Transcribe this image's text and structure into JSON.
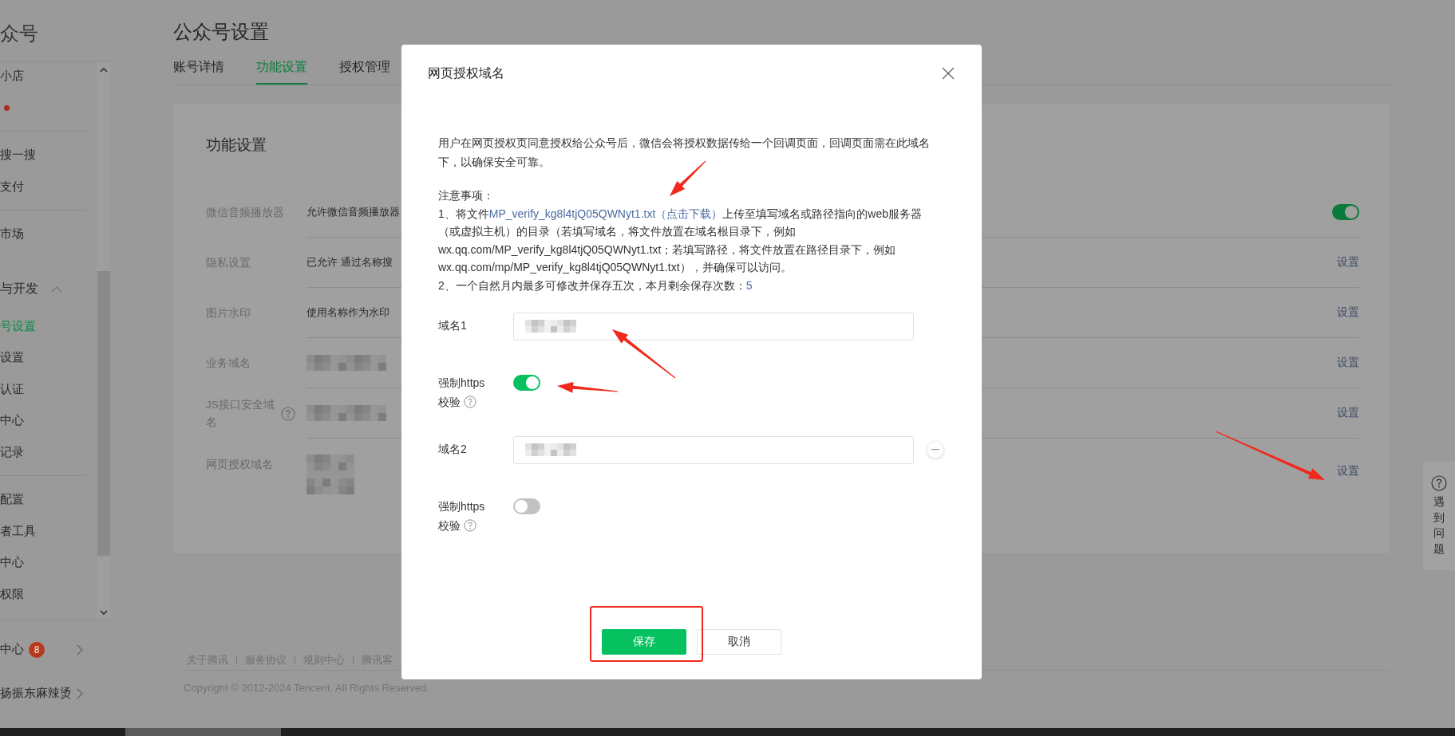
{
  "sidebar": {
    "title": "众号",
    "groups": [
      {
        "divider_after": true,
        "items": [
          {
            "kind": "link",
            "label": "小店",
            "selected": false
          },
          {
            "kind": "dot",
            "selected": false
          }
        ]
      },
      {
        "divider_after": true,
        "items": [
          {
            "kind": "link",
            "label": "搜一搜",
            "selected": false
          },
          {
            "kind": "link",
            "label": "支付",
            "selected": false
          }
        ]
      },
      {
        "divider_after": false,
        "items": [
          {
            "kind": "link",
            "label": "市场",
            "selected": false
          }
        ]
      },
      {
        "divider_after": true,
        "header": {
          "label": "与开发",
          "expanded": true
        },
        "items": [
          {
            "kind": "link",
            "label": "号设置",
            "selected": true
          },
          {
            "kind": "link",
            "label": "设置",
            "selected": false
          },
          {
            "kind": "link",
            "label": "认证",
            "selected": false
          },
          {
            "kind": "link",
            "label": "中心",
            "selected": false
          },
          {
            "kind": "link",
            "label": "记录",
            "selected": false
          }
        ]
      },
      {
        "divider_after": false,
        "items": [
          {
            "kind": "link",
            "label": "配置",
            "selected": false
          },
          {
            "kind": "link",
            "label": "者工具",
            "selected": false
          },
          {
            "kind": "link",
            "label": "中心",
            "selected": false
          },
          {
            "kind": "link",
            "label": "权限",
            "selected": false
          }
        ]
      }
    ],
    "bottom_items": [
      {
        "label": "中心",
        "badge": "8"
      },
      {
        "label": "扬振东麻辣烫"
      }
    ]
  },
  "page": {
    "title": "公众号设置",
    "tabs": [
      {
        "label": "账号详情",
        "selected": false
      },
      {
        "label": "功能设置",
        "selected": true
      },
      {
        "label": "授权管理",
        "selected": false
      }
    ]
  },
  "settings": {
    "title": "功能设置",
    "rows": [
      {
        "kind": "toggle",
        "label": "微信音频播放器",
        "value": "允许微信音频播放器",
        "on": true
      },
      {
        "kind": "link",
        "label": "隐私设置",
        "value": "已允许 通过名称搜",
        "action": "设置"
      },
      {
        "kind": "link",
        "label": "图片水印",
        "value": "使用名称作为水印",
        "action": "设置"
      },
      {
        "kind": "link",
        "label": "业务域名",
        "redacted": true,
        "redacted_multiline": false,
        "action": "设置"
      },
      {
        "kind": "link",
        "label": "JS接口安全域名",
        "help": true,
        "redacted": true,
        "redacted_multiline": false,
        "action": "设置"
      },
      {
        "kind": "link",
        "label": "网页授权域名",
        "redacted": true,
        "redacted_multiline": true,
        "action": "设置"
      }
    ]
  },
  "footer": {
    "links": [
      "关于腾讯",
      "服务协议",
      "规则中心",
      "腾讯客"
    ],
    "copyright": "Copyright © 2012-2024 Tencent. All Rights Reserved."
  },
  "help_float": {
    "label": "遇到问题"
  },
  "modal": {
    "title": "网页授权域名",
    "intro": "用户在网页授权页同意授权给公众号后，微信会将授权数据传给一个回调页面，回调页面需在此域名下，以确保安全可靠。",
    "notes_title": "注意事项：",
    "note_1": {
      "before": "1、将文件",
      "link": "MP_verify_kg8l4tjQ05QWNyt1.txt（点击下载）",
      "after": "上传至填写域名或路径指向的web服务器（或虚拟主机）的目录（若填写域名，将文件放置在域名根目录下，例如wx.qq.com/MP_verify_kg8l4tjQ05QWNyt1.txt；若填写路径，将文件放置在路径目录下，例如wx.qq.com/mp/MP_verify_kg8l4tjQ05QWNyt1.txt），并确保可以访问。"
    },
    "note_2": {
      "text": "2、一个自然月内最多可修改并保存五次，本月剩余保存次数：",
      "count": "5"
    },
    "domains": [
      {
        "label": "域名1",
        "value_redacted": true,
        "removable": false,
        "https_label": "强制https",
        "https_label_2": "校验",
        "https_enforced": true
      },
      {
        "label": "域名2",
        "value_redacted": true,
        "removable": true,
        "https_label": "强制https",
        "https_label_2": "校验",
        "https_enforced": false
      }
    ],
    "buttons": {
      "primary": "保存",
      "secondary": "取消"
    }
  }
}
